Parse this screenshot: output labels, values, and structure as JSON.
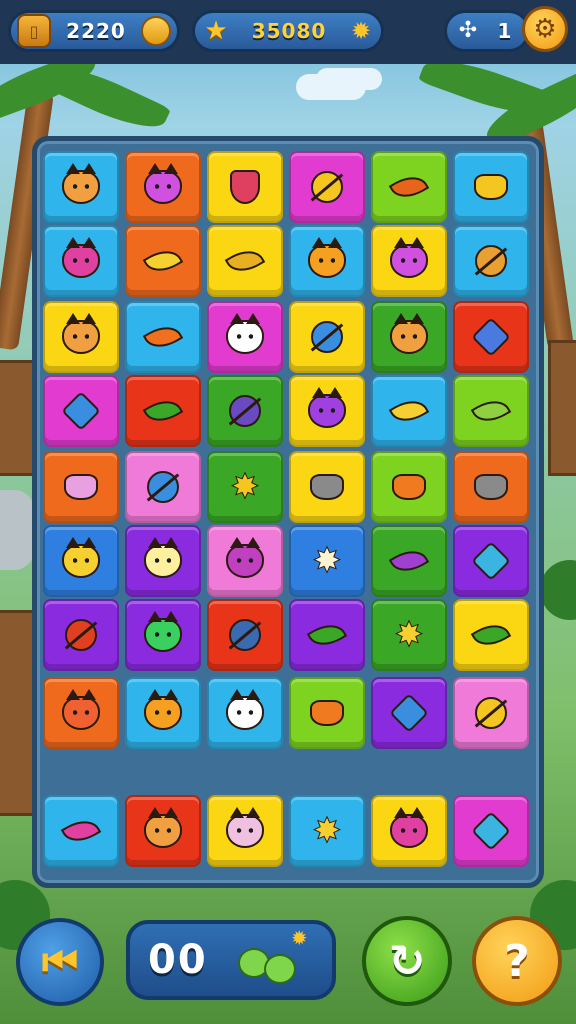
{
  "hud": {
    "coins": "2220",
    "score": "35080",
    "level": "1",
    "coin_icon": "bucket-icon",
    "score_icon": "star-icon",
    "level_icon": "puzzle-icon",
    "settings_icon": "gear-icon"
  },
  "colors": {
    "cyan": "#2fb4ec",
    "orange": "#f06a1e",
    "yellow": "#fbd613",
    "magenta": "#e23bd0",
    "lime": "#7ed321",
    "red": "#e8351a",
    "purple": "#8a2be0",
    "blue": "#2f7fe0",
    "green": "#3aa826",
    "pink": "#f07ad8"
  },
  "tiles": [
    [
      "cyan:cat:#f0a040",
      "orange:cat:#d050e0",
      "yellow:shield:#e04060",
      "magenta:ball:#f5c520",
      "lime:leaf:#e8641a",
      "cyan:pot:#f5c520"
    ],
    [
      "cyan:cat:#e040a0",
      "orange:leaf:#f5d030",
      "yellow:leaf:#e8b020",
      "cyan:cat:#f5a020",
      "yellow:cat:#d050e0",
      "cyan:ball:#e8a030"
    ],
    [
      "yellow:cat:#f0a040",
      "cyan:leaf:#f07020",
      "magenta:cat:#ffffff",
      "yellow:ball:#3a8ee0",
      "green:cat:#f0a040",
      "red:gem:#4a7ae0"
    ],
    [
      "magenta:gem:#3a8ee0",
      "red:leaf:#3aa826",
      "green:ball:#6a4ac0",
      "yellow:cat:#a040e0",
      "cyan:leaf:#f5d030",
      "lime:leaf:#8ed040"
    ],
    [
      "orange:pot:#e8a0e0",
      "pink:ball:#3a8ee0",
      "green:star:#f5c520",
      "yellow:pot:#8a8a8a",
      "lime:pot:#f07a20",
      "orange:pot:#8a8a8a"
    ],
    [
      "blue:cat:#f5d030",
      "purple:cat:#fff0a0",
      "pink:cat:#c040c0",
      "blue:star:#fff4d0",
      "green:leaf:#a040d0",
      "purple:gem:#3ab4e0"
    ],
    [
      "purple:ball:#e04020",
      "purple:cat:#3ad060",
      "red:ball:#3a6ab0",
      "purple:leaf:#3aa826",
      "green:star:#f5d030",
      "yellow:leaf:#3aa826"
    ],
    [
      "orange:cat:#f06030",
      "cyan:cat:#f5a020",
      "cyan:cat:#ffffff",
      "lime:pot:#f07a20",
      "purple:gem:#3a8ee0",
      "pink:ball:#f5c520"
    ],
    [
      "cyan:leaf:#e040a0",
      "red:cat:#f0a040",
      "yellow:cat:#f0c0e0",
      "cyan:star:#f5d030",
      "yellow:cat:#e040a0",
      "magenta:gem:#3ab4e0"
    ]
  ],
  "controls": {
    "moves": "00",
    "back_icon": "rewind-icon",
    "shuffle_icon": "refresh-icon",
    "hint_icon": "question-icon",
    "back_glyph": "⏮",
    "shuffle_glyph": "↻",
    "hint_glyph": "?"
  }
}
